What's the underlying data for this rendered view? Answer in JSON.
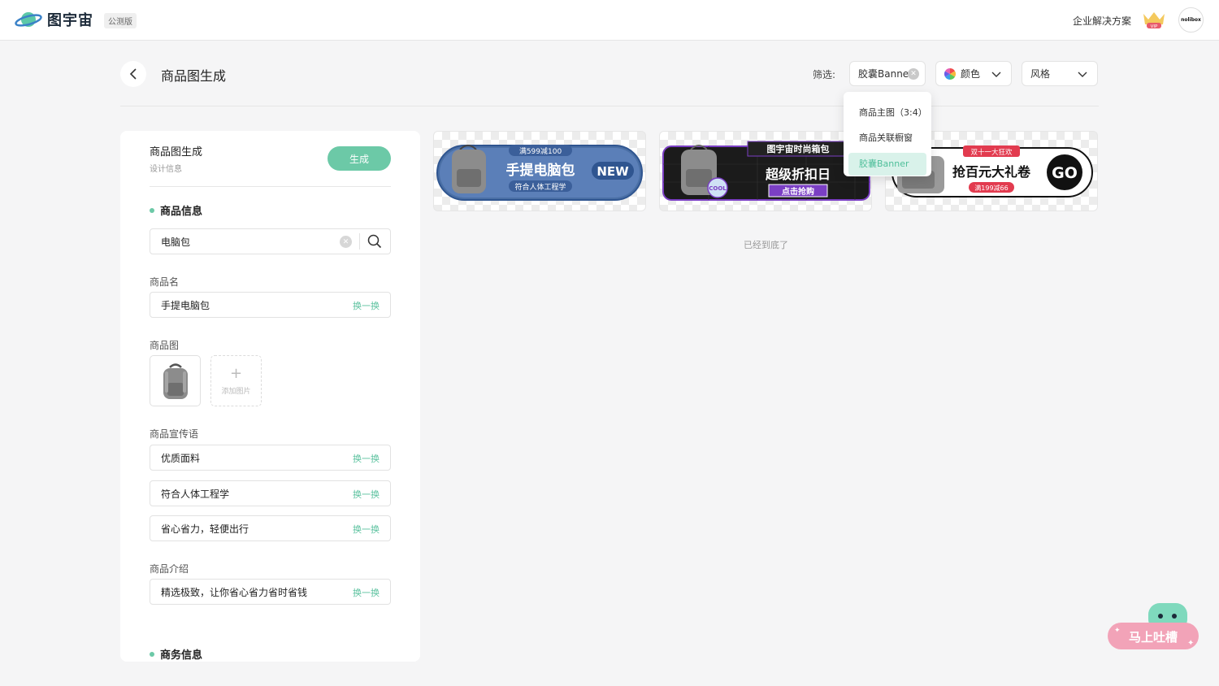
{
  "header": {
    "logo_text": "图宇宙",
    "beta_label": "公测版",
    "enterprise_link": "企业解决方案",
    "vip_badge": "VIP",
    "avatar_text": "nolibox"
  },
  "page": {
    "title": "商品图生成",
    "filter_label": "筛选:",
    "filters": {
      "type_value": "胶囊Banner",
      "color_label": "颜色",
      "style_label": "风格"
    },
    "dropdown_items": [
      "商品主图（3:4）",
      "商品关联橱窗",
      "胶囊Banner"
    ],
    "dropdown_selected": "胶囊Banner",
    "end_text": "已经到底了"
  },
  "panel": {
    "title": "商品图生成",
    "subtitle": "设计信息",
    "generate_button": "生成",
    "section_product": "商品信息",
    "search_value": "电脑包",
    "name_label": "商品名",
    "name_value": "手提电脑包",
    "image_label": "商品图",
    "add_image_label": "添加图片",
    "slogan_label": "商品宣传语",
    "slogans": [
      "优质面料",
      "符合人体工程学",
      "省心省力，轻便出行"
    ],
    "intro_label": "商品介绍",
    "intro_value": "精选极致，让你省心省力省时省钱",
    "swap_label": "换一换",
    "section_business": "商务信息"
  },
  "banners": [
    {
      "top_tag": "满599减100",
      "headline": "手提电脑包",
      "badge": "NEW",
      "sub": "符合人体工程学"
    },
    {
      "top_tag": "图宇宙时尚箱包",
      "headline": "超级折扣日",
      "sub": "点击抢购",
      "sticker": "COOL"
    },
    {
      "top_tag": "双十一大狂欢",
      "headline": "抢百元大礼卷",
      "sub": "满199减66",
      "badge": "GO"
    }
  ],
  "feedback_label": "马上吐槽",
  "colors": {
    "accent": "#6cc9a7",
    "accent_text": "#5cc29f",
    "banner1": "#4a6fa5",
    "banner2": "#7b3fc4"
  }
}
